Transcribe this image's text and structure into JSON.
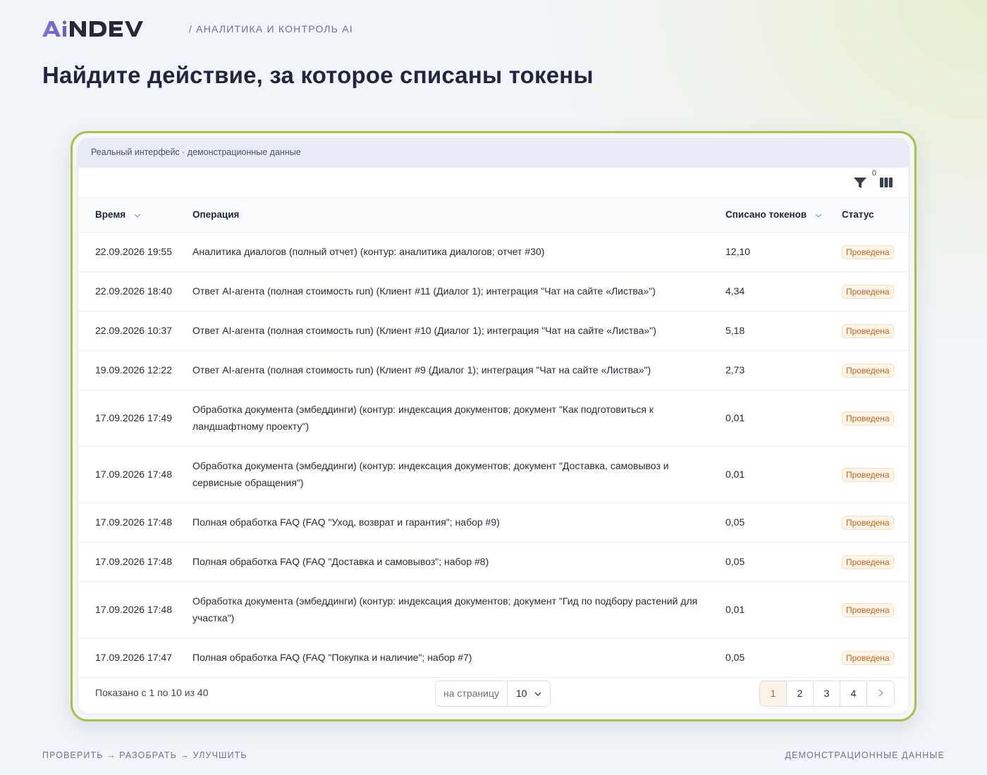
{
  "brand": {
    "logo_text": "AiNDEV",
    "tagline": "/ Аналитика и контроль AI",
    "accent_color": "#7f74d6"
  },
  "page_title": "Найдите действие, за которое списаны токены",
  "banner": "Реальный интерфейс · демонстрационные данные",
  "toolbar": {
    "filter_icon": "filter-icon",
    "filter_count": "0",
    "columns_icon": "columns-icon"
  },
  "table": {
    "headers": {
      "time": "Время",
      "operation": "Операция",
      "tokens": "Списано токенов",
      "status": "Статус"
    },
    "rows": [
      {
        "time": "22.09.2026 19:55",
        "operation": "Аналитика диалогов (полный отчет) (контур: аналитика диалогов; отчет #30)",
        "tokens": "12,10",
        "status": "Проведена"
      },
      {
        "time": "22.09.2026 18:40",
        "operation": "Ответ AI-агента (полная стоимость run) (Клиент #11 (Диалог 1); интеграция \"Чат на сайте «Листва»\")",
        "tokens": "4,34",
        "status": "Проведена"
      },
      {
        "time": "22.09.2026 10:37",
        "operation": "Ответ AI-агента (полная стоимость run) (Клиент #10 (Диалог 1); интеграция \"Чат на сайте «Листва»\")",
        "tokens": "5,18",
        "status": "Проведена"
      },
      {
        "time": "19.09.2026 12:22",
        "operation": "Ответ AI-агента (полная стоимость run) (Клиент #9 (Диалог 1); интеграция \"Чат на сайте «Листва»\")",
        "tokens": "2,73",
        "status": "Проведена"
      },
      {
        "time": "17.09.2026 17:49",
        "operation": "Обработка документа (эмбеддинги) (контур: индексация документов; документ \"Как подготовиться к ландшафтному проекту\")",
        "tokens": "0,01",
        "status": "Проведена"
      },
      {
        "time": "17.09.2026 17:48",
        "operation": "Обработка документа (эмбеддинги) (контур: индексация документов; документ \"Доставка, самовывоз и сервисные обращения\")",
        "tokens": "0,01",
        "status": "Проведена"
      },
      {
        "time": "17.09.2026 17:48",
        "operation": "Полная обработка FAQ (FAQ \"Уход, возврат и гарантия\"; набор #9)",
        "tokens": "0,05",
        "status": "Проведена"
      },
      {
        "time": "17.09.2026 17:48",
        "operation": "Полная обработка FAQ (FAQ \"Доставка и самовывоз\"; набор #8)",
        "tokens": "0,05",
        "status": "Проведена"
      },
      {
        "time": "17.09.2026 17:48",
        "operation": "Обработка документа (эмбеддинги) (контур: индексация документов; документ \"Гид по подбору растений для участка\")",
        "tokens": "0,01",
        "status": "Проведена"
      },
      {
        "time": "17.09.2026 17:47",
        "operation": "Полная обработка FAQ (FAQ \"Покупка и наличие\"; набор #7)",
        "tokens": "0,05",
        "status": "Проведена"
      }
    ]
  },
  "pagination": {
    "shown_text": "Показано с 1 по 10 из 40",
    "per_page_label": "на страницу",
    "per_page_value": "10",
    "pages": [
      "1",
      "2",
      "3",
      "4"
    ],
    "active_page": "1",
    "next_icon": "chevron-right-icon"
  },
  "footer": {
    "left": "Проверить → Разобрать → Улучшить",
    "right": "Демонстрационные данные"
  },
  "status_color": "#c8611e",
  "frame_color": "#a3c34a"
}
